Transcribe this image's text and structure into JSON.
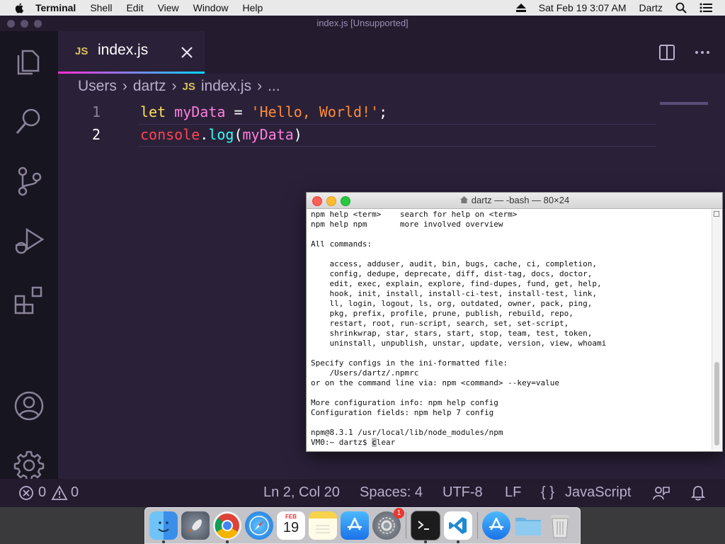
{
  "menubar": {
    "items": [
      "Terminal",
      "Shell",
      "Edit",
      "View",
      "Window",
      "Help"
    ],
    "datetime": "Sat Feb 19  3:07 AM",
    "user": "Dartz"
  },
  "vscode": {
    "window_title": "index.js [Unsupported]",
    "tab": {
      "icon_text": "JS",
      "label": "index.js"
    },
    "breadcrumb": {
      "parts": [
        "Users",
        "dartz"
      ],
      "file": "index.js",
      "more": "..."
    },
    "code": {
      "line_numbers": [
        "1",
        "2"
      ],
      "line1": {
        "kw": "let",
        "var": "myData",
        "op": " = ",
        "str": "'Hello, World!'",
        "end": ";"
      },
      "line2": {
        "obj": "console",
        "dot": ".",
        "fn": "log",
        "open": "(",
        "arg": "myData",
        "close": ")"
      }
    },
    "status": {
      "errors": "0",
      "warnings": "0",
      "position": "Ln 2, Col 20",
      "spaces": "Spaces: 4",
      "encoding": "UTF-8",
      "eol": "LF",
      "language": "JavaScript"
    }
  },
  "terminal": {
    "title": "dartz — -bash — 80×24",
    "output": "npm help <term>    search for help on <term>\nnpm help npm       more involved overview\n\nAll commands:\n\n    access, adduser, audit, bin, bugs, cache, ci, completion,\n    config, dedupe, deprecate, diff, dist-tag, docs, doctor,\n    edit, exec, explain, explore, find-dupes, fund, get, help,\n    hook, init, install, install-ci-test, install-test, link,\n    ll, login, logout, ls, org, outdated, owner, pack, ping,\n    pkg, prefix, profile, prune, publish, rebuild, repo,\n    restart, root, run-script, search, set, set-script,\n    shrinkwrap, star, stars, start, stop, team, test, token,\n    uninstall, unpublish, unstar, update, version, view, whoami\n\nSpecify configs in the ini-formatted file:\n    /Users/dartz/.npmrc\nor on the command line via: npm <command> --key=value\n\nMore configuration info: npm help config\nConfiguration fields: npm help 7 config\n\nnpm@8.3.1 /usr/local/lib/node_modules/npm",
    "prompt": "VM0:~ dartz$ ",
    "typed": "clear"
  },
  "dock": {
    "calendar_month": "FEB",
    "calendar_day": "19",
    "badge_count": "1",
    "icons": [
      "finder-icon",
      "launchpad-icon",
      "chrome-icon",
      "safari-icon",
      "calendar-icon",
      "notes-icon",
      "app-store-icon",
      "system-preferences-icon",
      "terminal-icon",
      "vscode-icon",
      "app-store-icon",
      "folder-icon",
      "trash-icon"
    ]
  },
  "colors": {
    "editor_bg": "#2a2139",
    "activity_bg": "#171520",
    "accent_pink": "#ff2bd6",
    "accent_cyan": "#00d8ff",
    "keyword": "#fede5d",
    "variable": "#ff7edb",
    "string": "#ff8b39"
  }
}
